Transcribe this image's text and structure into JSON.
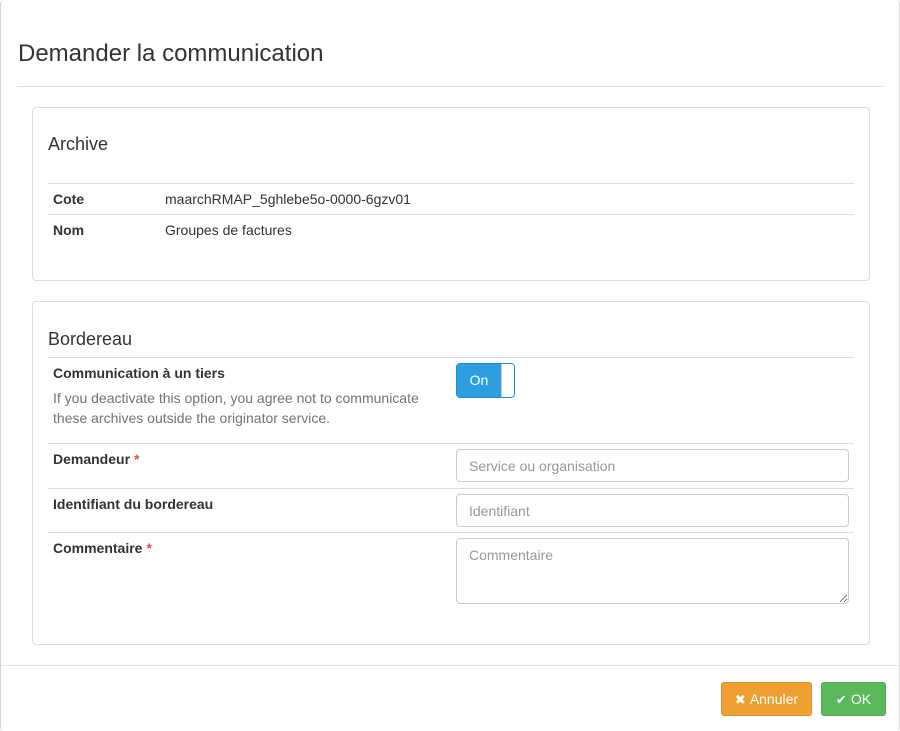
{
  "modal": {
    "title": "Demander la communication"
  },
  "archive": {
    "title": "Archive",
    "rows": [
      {
        "label": "Cote",
        "value": "maarchRMAP_5ghlebe5o-0000-6gzv01"
      },
      {
        "label": "Nom",
        "value": "Groupes de factures"
      }
    ]
  },
  "bordereau": {
    "title": "Bordereau",
    "communication": {
      "label": "Communication à un tiers",
      "help": "If you deactivate this option, you agree not to communicate these archives outside the originator service.",
      "toggle_label": "On",
      "toggle_state": true
    },
    "demandeur": {
      "label": "Demandeur",
      "required_mark": "*",
      "placeholder": "Service ou organisation",
      "value": ""
    },
    "identifiant": {
      "label": "Identifiant du bordereau",
      "placeholder": "Identifiant",
      "value": ""
    },
    "commentaire": {
      "label": "Commentaire",
      "required_mark": "*",
      "placeholder": "Commentaire",
      "value": ""
    }
  },
  "footer": {
    "cancel_label": "Annuler",
    "cancel_icon": "times-icon",
    "ok_label": "OK",
    "ok_icon": "check-icon"
  },
  "colors": {
    "cancel": "#f0a030",
    "ok": "#5cb85c",
    "toggle": "#2d9fe0",
    "required": "#d9534f"
  }
}
